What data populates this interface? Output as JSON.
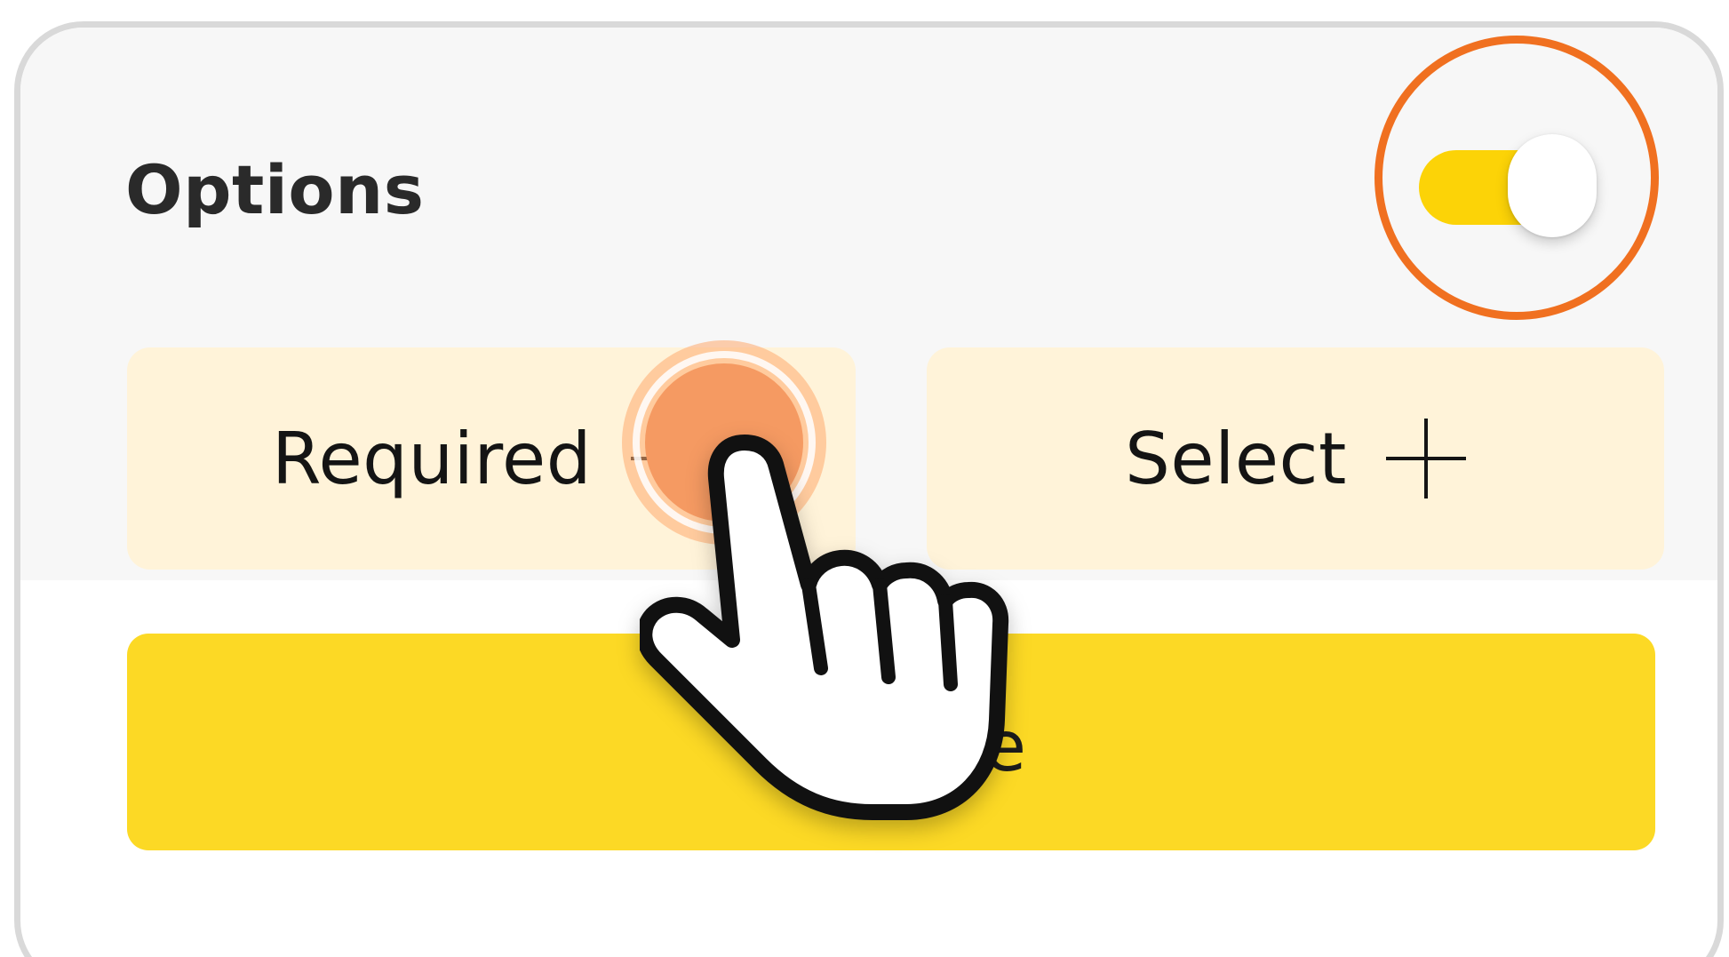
{
  "card": {
    "title": "Options",
    "toggle": {
      "state": "on",
      "track_color": "#fcd307",
      "knob_color": "#ffffff"
    },
    "highlight_color": "#f07020"
  },
  "chips": [
    {
      "label": "Required",
      "icon": "plus-icon"
    },
    {
      "label": "Select",
      "icon": "plus-icon"
    }
  ],
  "chip_color": "#fff3d9",
  "primary_button": {
    "label": "e",
    "color": "#fcd925"
  },
  "pointer": {
    "icon": "hand-pointer-icon",
    "tap_color": "#f59a62"
  }
}
